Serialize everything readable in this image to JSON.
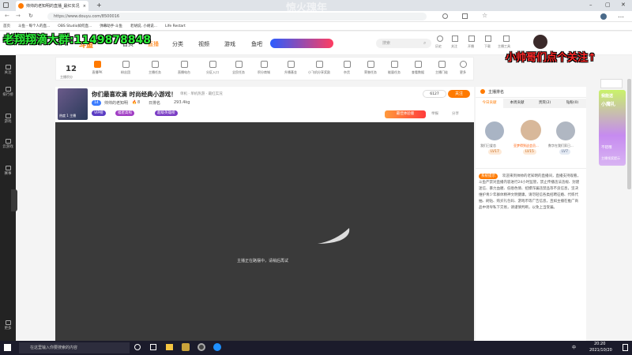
{
  "browser": {
    "tab_title": "帅帅的老知明的直播_最红实况",
    "url": "https://www.douyu.com/8500016",
    "new_tab": "+",
    "bookmarks": [
      "首页",
      "斗鱼 - 每个人的直...",
      "OBS Studio如何直...",
      "弹幕助手-斗鱼",
      "老胡说, 小胡说...",
      "Life Restart"
    ],
    "watermark": "惊火瑰年"
  },
  "overlay": {
    "qq_group": "老翔翔滴大群:1149878848",
    "follow_prompt": "小帅哥们点个关注↑"
  },
  "site": {
    "logo": "斗鱼",
    "nav": [
      "首页",
      "直播",
      "分类",
      "视频",
      "游戏",
      "鱼吧"
    ],
    "search_placeholder": "搜索",
    "header_icons": [
      "历史",
      "关注",
      "开播",
      "下载",
      "主播工具"
    ]
  },
  "sidebar": [
    "关注",
    "排行榜",
    "游戏",
    "云游戏",
    "赛事",
    "更多"
  ],
  "toolbar": {
    "level_num": "12",
    "level_label": "主播积分",
    "items": [
      "直播PK",
      "粉丝团",
      "主播任务",
      "直播电台",
      "分区入口",
      "全民任务",
      "积分商城",
      "升播基金",
      "小飞机分享奖励",
      "杂货",
      "荣誉任务",
      "能量任务",
      "查看数据",
      "主播门徒",
      "更多"
    ]
  },
  "stream": {
    "title": "你们最喜欢滴 时尚经典小游戏！",
    "category": "单机 · 单机热游 · 最红实况",
    "badge_num": "14",
    "streamer": "帅帅的老知明",
    "hot_label": "8",
    "rank": "日排名",
    "followers": "293.4kg",
    "viewer_count": "6127",
    "follow_btn": "关注",
    "report": "举报",
    "share": "分享",
    "vip_tag": "VIP榜",
    "event_tag": "福星高照",
    "award_tag": "超级英雄榜",
    "avatar_label": "热度 1 主播",
    "room_tag": "最佳体验版"
  },
  "player": {
    "status_text": "主播正在路摆中，请稍后再试"
  },
  "rightpanel": {
    "header": "主播排名",
    "tabs": [
      "今日贡献",
      "本周贡献",
      "贵宾(2)",
      "钻粉(0)"
    ],
    "ranks": [
      {
        "name": "我们已爱恋",
        "badge": "LV17"
      },
      {
        "name": "亚梦得到这会员...",
        "badge": "LV15"
      },
      {
        "name": "数字在我们家已...",
        "badge": "LV7"
      }
    ],
    "system_tag": "系统提示",
    "system_text": "欢迎来到帅帅的老知明的直播间，直播支持观看，斗鱼严禁对直播内容进行24小时监管，禁止传播违法违规、封建迷信、暴力血腥、低俗色情、招嫖诈骗违禁品等不良信息，坚决维护青少年群体精神文明健康。请勿轻信各类招聘征婚、代练代抽、刷钻、购买礼包码、游戏币等广告信息，且如主播在推广商品中诱导私下交易，请谨慎判断，以免上当受骗。"
  },
  "promo": {
    "top": "我能送",
    "main": "小魔礼",
    "bottom": "不错哦",
    "footer": "主播领奖提示"
  },
  "taskbar": {
    "search_placeholder": "在这里输入你要搜索的内容",
    "time": "20:20",
    "date": "2021/10/20",
    "input_lang": "中"
  },
  "colors": {
    "accent": "#ff7a00",
    "player_bg": "#3a3a3a",
    "overlay_green": "#2ef03a",
    "overlay_red": "#ff2a2a"
  }
}
